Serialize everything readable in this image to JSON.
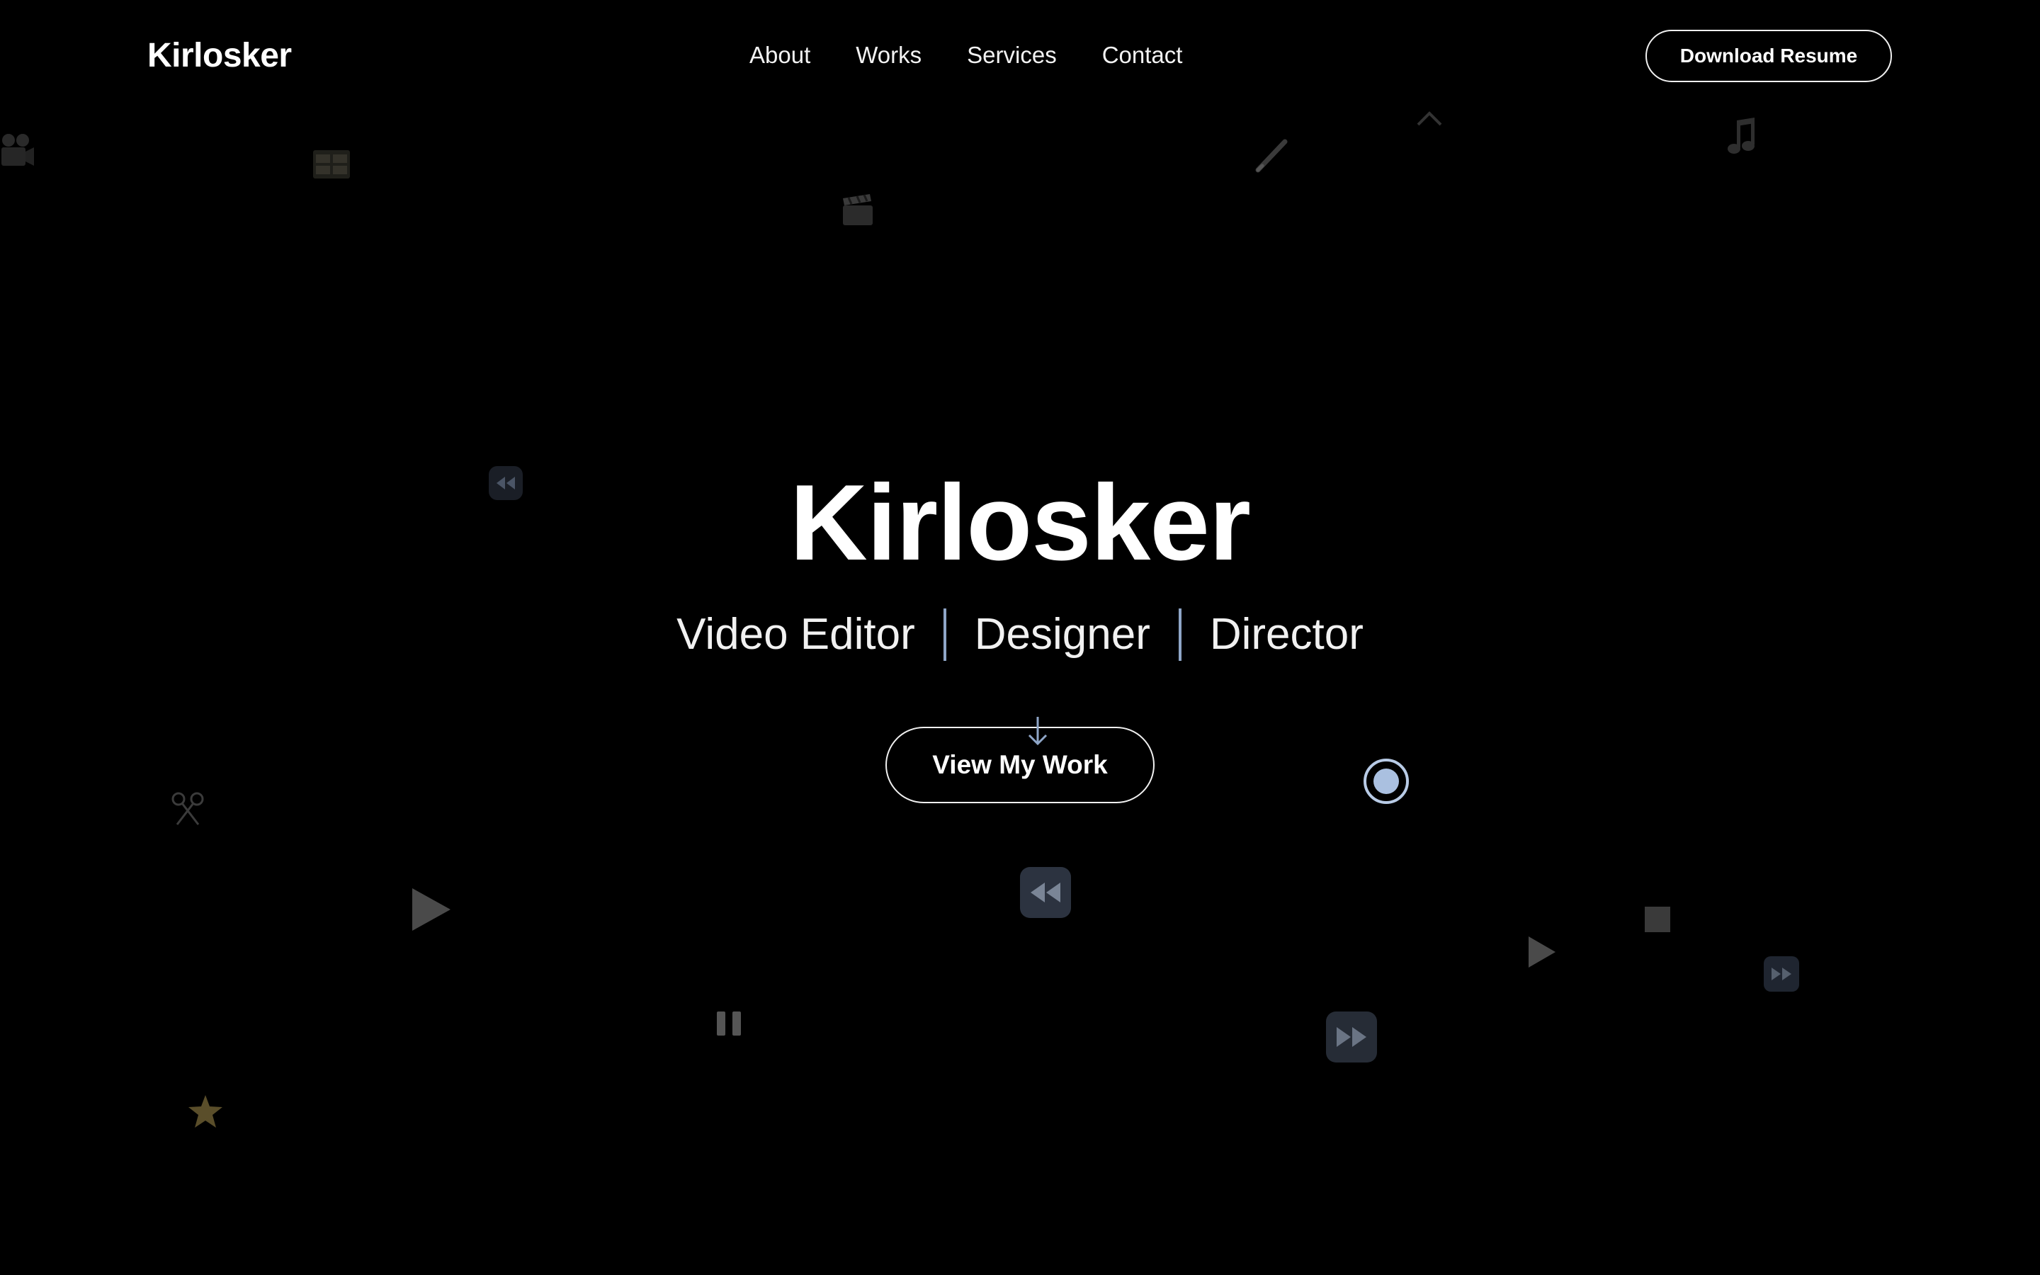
{
  "nav": {
    "brand": "Kirlosker",
    "links": [
      "About",
      "Works",
      "Services",
      "Contact"
    ],
    "resume_label": "Download Resume"
  },
  "hero": {
    "title": "Kirlosker",
    "roles": [
      "Video Editor",
      "Designer",
      "Director"
    ],
    "cta_label": "View My Work"
  },
  "colors": {
    "background": "#000000",
    "text": "#ffffff",
    "accent": "#8fa6c8"
  },
  "icons": [
    "film-camera-icon",
    "film-reel-icon",
    "clapperboard-icon",
    "pen-icon",
    "music-note-icon",
    "rewind-icon",
    "scissors-icon",
    "play-icon",
    "pause-icon",
    "star-icon",
    "stop-icon",
    "fast-forward-icon",
    "record-icon",
    "arrow-down-icon"
  ]
}
